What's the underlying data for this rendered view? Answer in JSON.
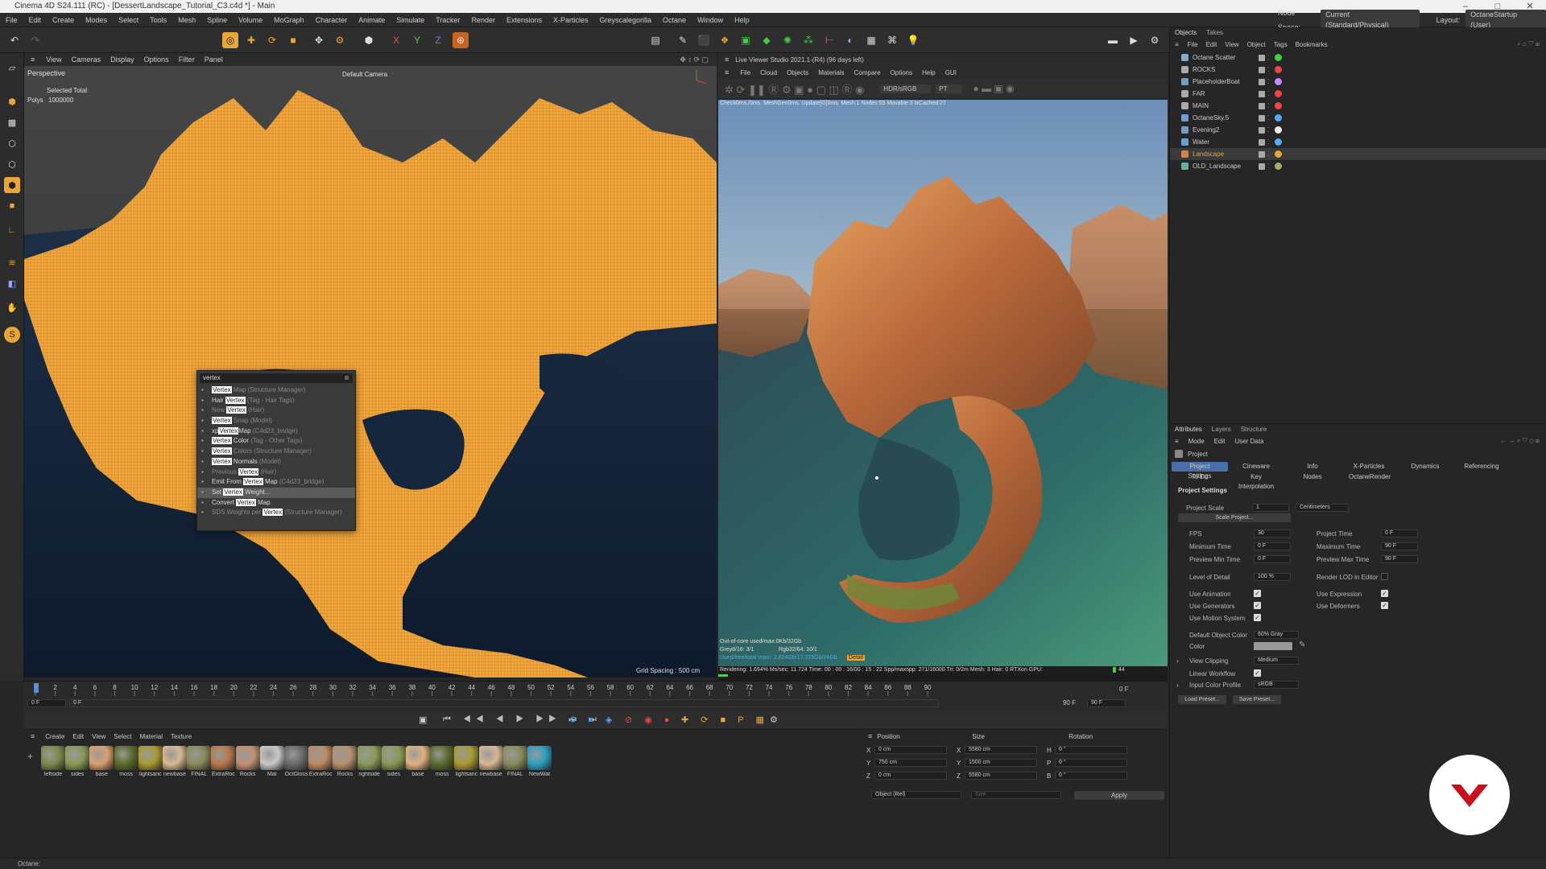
{
  "title": "Cinema 4D S24.111 (RC) - [DessertLandscape_Tutorial_C3.c4d *] - Main",
  "menu": [
    "File",
    "Edit",
    "Create",
    "Modes",
    "Select",
    "Tools",
    "Mesh",
    "Spline",
    "Volume",
    "MoGraph",
    "Character",
    "Animate",
    "Simulate",
    "Tracker",
    "Render",
    "Extensions",
    "X-Particles",
    "Greyscalegorilla",
    "Octane",
    "Window",
    "Help"
  ],
  "node_space_label": "Node Space:",
  "node_space_value": "Current (Standard/Physical)",
  "layout_label": "Layout:",
  "layout_value": "OctaneStartup (User)",
  "viewport": {
    "menu": [
      "View",
      "Cameras",
      "Display",
      "Options",
      "Filter",
      "Panel"
    ],
    "name": "Perspective",
    "camera": "Default Camera",
    "stats_header": "Selected Total",
    "polys_label": "Polys",
    "polys_value": "1000000",
    "grid_spacing": "Grid Spacing : 500 cm"
  },
  "popup": {
    "query": "vertex",
    "items": [
      {
        "pre": "",
        "hl": "Vertex",
        "post": " Map",
        "sub": " (Structure Manager)",
        "dim": true
      },
      {
        "pre": "Hair ",
        "hl": "Vertex",
        "post": "",
        "sub": " (Tag - Hair Tags)",
        "dim": false
      },
      {
        "pre": "New ",
        "hl": "Vertex",
        "post": "",
        "sub": " (Hair)",
        "dim": true
      },
      {
        "pre": "",
        "hl": "Vertex",
        "post": " Snap",
        "sub": " (Model)",
        "dim": true
      },
      {
        "pre": "xp",
        "hl": "Vertex",
        "post": "Map",
        "sub": " (C4d23_bridge)",
        "dim": false
      },
      {
        "pre": "",
        "hl": "Vertex",
        "post": " Color",
        "sub": " (Tag - Other Tags)",
        "dim": false
      },
      {
        "pre": "",
        "hl": "Vertex",
        "post": " Colors",
        "sub": " (Structure Manager)",
        "dim": true
      },
      {
        "pre": "",
        "hl": "Vertex",
        "post": " Normals",
        "sub": " (Model)",
        "dim": false
      },
      {
        "pre": "Previous ",
        "hl": "Vertex",
        "post": "",
        "sub": " (Hair)",
        "dim": true
      },
      {
        "pre": "Emit From ",
        "hl": "Vertex",
        "post": " Map",
        "sub": " (C4d23_bridge)",
        "dim": false
      },
      {
        "pre": "Set ",
        "hl": "Vertex",
        "post": " Weight...",
        "sub": "",
        "dim": false
      },
      {
        "pre": "Convert ",
        "hl": "Vertex",
        "post": " Map",
        "sub": "",
        "dim": false
      },
      {
        "pre": "SDS Weights per ",
        "hl": "Vertex",
        "post": "",
        "sub": " (Structure Manager)",
        "dim": true
      }
    ]
  },
  "live_viewer": {
    "title": "Live Viewer Studio 2021.1-(R4) (96 days left)",
    "menu": [
      "File",
      "Cloud",
      "Objects",
      "Materials",
      "Compare",
      "Options",
      "Help",
      "GUI"
    ],
    "mode": "HDR/sRGB",
    "kernel": "PT",
    "info": "Check0ms./0ms. MeshGen0ms. Update[G]0ms. Mesh:1 Nodes:55 Movable:3 txCached:27",
    "status1": "Out-of-core used/max:0Kb/32Gb",
    "status2": "Grey8/16: 3/1",
    "status3": "Rgb32/64: 10/1",
    "status4": "Used/free/total vram: 2.824Gb/17.725Gb/24Gb",
    "status5": "Rendering: 1.694%   Ms/sec: 11.724   Time: 00 : 00 : 16/00 : 15 : 22   Spp/maxspp: 271/16000   Tri: 0/2m   Mesh: 3   Hair: 0   RTXon   GPU:",
    "gpu_value": "44",
    "detail_label": "Detail"
  },
  "timeline": {
    "ticks": [
      "0",
      "2",
      "4",
      "6",
      "8",
      "10",
      "12",
      "14",
      "16",
      "18",
      "20",
      "22",
      "24",
      "26",
      "28",
      "30",
      "32",
      "34",
      "36",
      "38",
      "40",
      "42",
      "44",
      "46",
      "48",
      "50",
      "52",
      "54",
      "56",
      "58",
      "60",
      "62",
      "64",
      "66",
      "68",
      "70",
      "72",
      "74",
      "76",
      "78",
      "80",
      "82",
      "84",
      "86",
      "88",
      "90"
    ],
    "start": "0 F",
    "current": "0 F",
    "end1": "90 F",
    "end2": "90 F",
    "right_frame": "0 F"
  },
  "materials": {
    "menu": [
      "Create",
      "Edit",
      "View",
      "Select",
      "Material",
      "Texture"
    ],
    "items": [
      {
        "name": "leftside",
        "color": "#7a8a4a"
      },
      {
        "name": "sides",
        "color": "#8a9a55"
      },
      {
        "name": "base",
        "color": "#d9a070"
      },
      {
        "name": "moss",
        "color": "#5a6a2a"
      },
      {
        "name": "lightsanc",
        "color": "#a89a30"
      },
      {
        "name": "newbase",
        "color": "#d8b890"
      },
      {
        "name": "FINAL",
        "color": "#8a8a5a"
      },
      {
        "name": "ExtraRoc",
        "color": "#b8784a"
      },
      {
        "name": "Rocks",
        "color": "#c09070"
      },
      {
        "name": "Mat",
        "color": "#c8c8c8"
      },
      {
        "name": "OctGloss",
        "color": "#6a6a6a"
      },
      {
        "name": "ExtraRoc",
        "color": "#c08a60"
      },
      {
        "name": "Rocks",
        "color": "#b89070"
      },
      {
        "name": "rightside",
        "color": "#8a9a5a"
      },
      {
        "name": "sides",
        "color": "#8a9a55"
      },
      {
        "name": "base",
        "color": "#e0b080"
      },
      {
        "name": "moss",
        "color": "#5a6a2a"
      },
      {
        "name": "lightsanc",
        "color": "#a89a30"
      },
      {
        "name": "newbase",
        "color": "#d8b890"
      },
      {
        "name": "FINAL",
        "color": "#8a8a5a"
      },
      {
        "name": "NewWat",
        "color": "#2aa0c0"
      }
    ]
  },
  "coords": {
    "headers": [
      "Position",
      "Size",
      "Rotation"
    ],
    "rows": [
      {
        "axis": "X",
        "pos": "0 cm",
        "saxis": "X",
        "size": "5580 cm",
        "raxis": "H",
        "rot": "0 °"
      },
      {
        "axis": "Y",
        "pos": "750 cm",
        "saxis": "Y",
        "size": "1500 cm",
        "raxis": "P",
        "rot": "0 °"
      },
      {
        "axis": "Z",
        "pos": "0 cm",
        "saxis": "Z",
        "size": "5580 cm",
        "raxis": "B",
        "rot": "0 °"
      }
    ],
    "mode": "Object (Rel)",
    "size_mode": "Size",
    "apply": "Apply"
  },
  "objects": {
    "tabs": [
      "Objects",
      "Takes"
    ],
    "menu": [
      "File",
      "Edit",
      "View",
      "Object",
      "Tags",
      "Bookmarks"
    ],
    "items": [
      {
        "name": "Octane Scatter",
        "color": "#7ab0d8",
        "hl": false
      },
      {
        "name": "ROCKS",
        "color": "#aaaaaa",
        "hl": false
      },
      {
        "name": "PlaceholderBoat",
        "color": "#6aa0d0",
        "hl": false
      },
      {
        "name": "FAR",
        "color": "#aaaaaa",
        "hl": false
      },
      {
        "name": "MAIN",
        "color": "#aaaaaa",
        "hl": false
      },
      {
        "name": "OctaneSky.5",
        "color": "#6aa0d0",
        "hl": false
      },
      {
        "name": "Evening2",
        "color": "#6aa0d0",
        "hl": false
      },
      {
        "name": "Water",
        "color": "#6aa0d0",
        "hl": false
      },
      {
        "name": "Landscape",
        "color": "#e0803a",
        "hl": true
      },
      {
        "name": "OLD_Landscape",
        "color": "#6ab0a0",
        "hl": false
      }
    ]
  },
  "attributes": {
    "tabs": [
      "Attributes",
      "Layers",
      "Structure"
    ],
    "menu": [
      "Mode",
      "Edit",
      "User Data"
    ],
    "object": "Project",
    "tabrow1": [
      "Project Settings",
      "Cineware",
      "Info",
      "X-Particles",
      "Dynamics",
      "Referencing"
    ],
    "tabrow2": [
      "To Do",
      "Key Interpolation",
      "Nodes",
      "OctaneRender"
    ],
    "section": "Project Settings",
    "project_scale_label": "Project Scale",
    "project_scale_value": "1",
    "project_scale_unit": "Centimeters",
    "scale_button": "Scale Project...",
    "fps_label": "FPS",
    "fps": "30",
    "project_time_label": "Project Time",
    "project_time": "0 F",
    "min_time_label": "Minimum Time",
    "min_time": "0 F",
    "max_time_label": "Maximum Time",
    "max_time": "90 F",
    "prev_min_label": "Preview Min Time",
    "prev_min": "0 F",
    "prev_max_label": "Preview Max Time",
    "prev_max": "90 F",
    "lod_label": "Level of Detail",
    "lod": "100 %",
    "render_lod_label": "Render LOD in Editor",
    "use_animation": "Use Animation",
    "use_expression": "Use Expression",
    "use_generators": "Use Generators",
    "use_deformers": "Use Deformers",
    "use_motion": "Use Motion System",
    "default_color_label": "Default Object Color",
    "default_color": "60% Gray",
    "color_label": "Color",
    "view_clipping_label": "View Clipping",
    "view_clipping": "Medium",
    "linear_workflow": "Linear Workflow",
    "input_color_label": "Input Color Profile",
    "input_color": "sRGB",
    "load_preset": "Load Preset...",
    "save_preset": "Save Preset..."
  },
  "status": "Octane:"
}
